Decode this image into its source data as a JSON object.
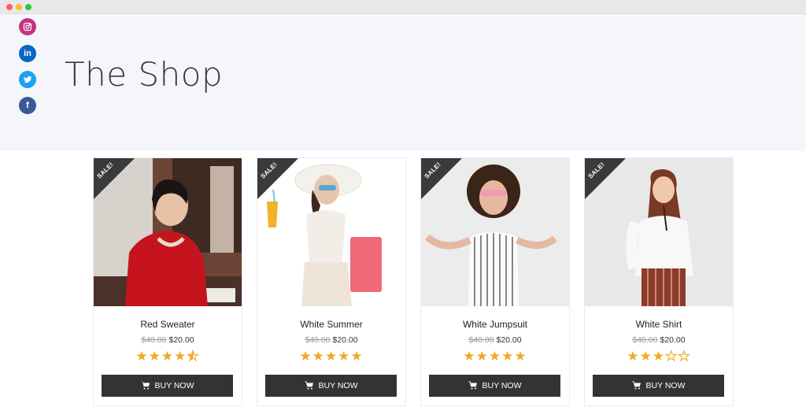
{
  "window": {
    "controls": [
      "close",
      "minimize",
      "maximize"
    ]
  },
  "hero": {
    "title": "The Shop",
    "background": "#f4f6fb"
  },
  "social": [
    {
      "name": "instagram",
      "icon": "instagram-icon",
      "color": "#c13584"
    },
    {
      "name": "linkedin",
      "icon": "linkedin-icon",
      "color": "#0a66c2",
      "glyph": "in"
    },
    {
      "name": "twitter",
      "icon": "twitter-icon",
      "color": "#1da1f2"
    },
    {
      "name": "facebook",
      "icon": "facebook-icon",
      "color": "#3b5998",
      "glyph": "f"
    }
  ],
  "products": [
    {
      "name": "Red Sweater",
      "badge": "SALE!",
      "old_price": "$40.00",
      "price": "$20.00",
      "rating": 4.5,
      "button": "BUY NOW",
      "image_bg": "#8a5a44"
    },
    {
      "name": "White Summer",
      "badge": "SALE!",
      "old_price": "$40.00",
      "price": "$20.00",
      "rating": 5,
      "button": "BUY NOW",
      "image_bg": "#ffffff"
    },
    {
      "name": "White Jumpsuit",
      "badge": "SALE!",
      "old_price": "$40.00",
      "price": "$20.00",
      "rating": 5,
      "button": "BUY NOW",
      "image_bg": "#ececec"
    },
    {
      "name": "White Shirt",
      "badge": "SALE!",
      "old_price": "$40.00",
      "price": "$20.00",
      "rating": 3,
      "button": "BUY NOW",
      "image_bg": "#e8e8e8"
    }
  ],
  "colors": {
    "star": "#f2a81d",
    "button": "#333333",
    "badge": "#3a3a3a"
  }
}
